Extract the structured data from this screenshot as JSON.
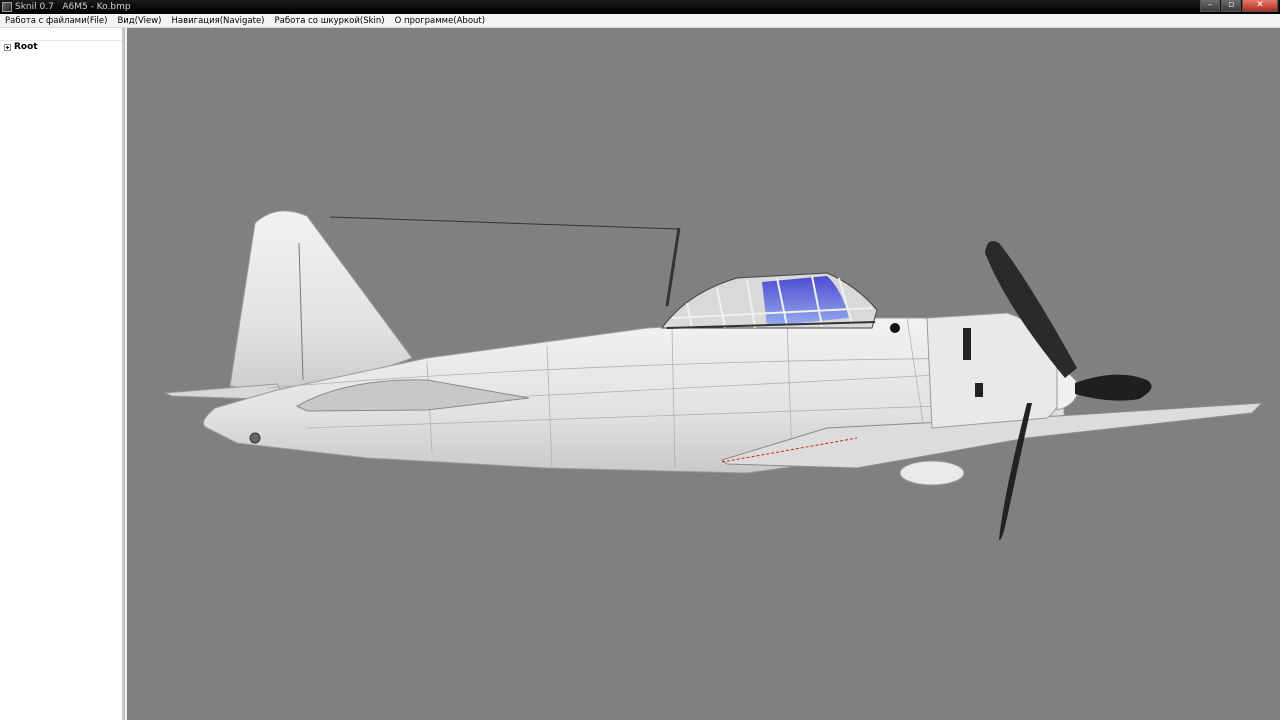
{
  "window": {
    "title": "Sknil 0.7   A6M5 - Ko.bmp"
  },
  "menu": [
    "Работа с файлами(File)",
    "Вид(View)",
    "Навигация(Navigate)",
    "Работа со шкуркой(Skin)",
    "О программе(About)"
  ],
  "tree": {
    "root_label": "Root"
  },
  "colors": {
    "viewport_bg": "#808080",
    "canopy_glass": "#5a5ad6",
    "fuselage": "#e6e6e6"
  },
  "icons": {
    "app": "app-icon",
    "minimize": "minimize-icon",
    "maximize": "maximize-icon",
    "close": "close-icon",
    "expand": "plus-expander-icon"
  }
}
